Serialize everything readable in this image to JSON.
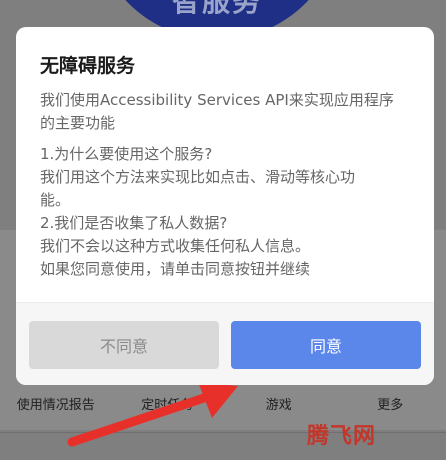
{
  "background": {
    "top_banner_text": "智服务",
    "bottom_items": [
      "使用情况报告",
      "定时任务",
      "游戏",
      "更多"
    ],
    "watermark": "腾飞网"
  },
  "dialog": {
    "title": "无障碍服务",
    "intro_lines": [
      "我们使用Accessibility Services API来实现应用程序",
      "的主要功能"
    ],
    "body_lines": [
      "1.为什么要使用这个服务?",
      "我们用这个方法来实现比如点击、滑动等核心功",
      "能。",
      "2.我们是否收集了私人数据?",
      "我们不会以这种方式收集任何私人信息。",
      "如果您同意使用，请单击同意按钮并继续"
    ],
    "disagree_label": "不同意",
    "agree_label": "同意"
  },
  "colors": {
    "agree_button": "#5b87ea",
    "disagree_button": "#d9d9d9",
    "arrow": "#e8302a",
    "watermark": "#c3372b"
  }
}
